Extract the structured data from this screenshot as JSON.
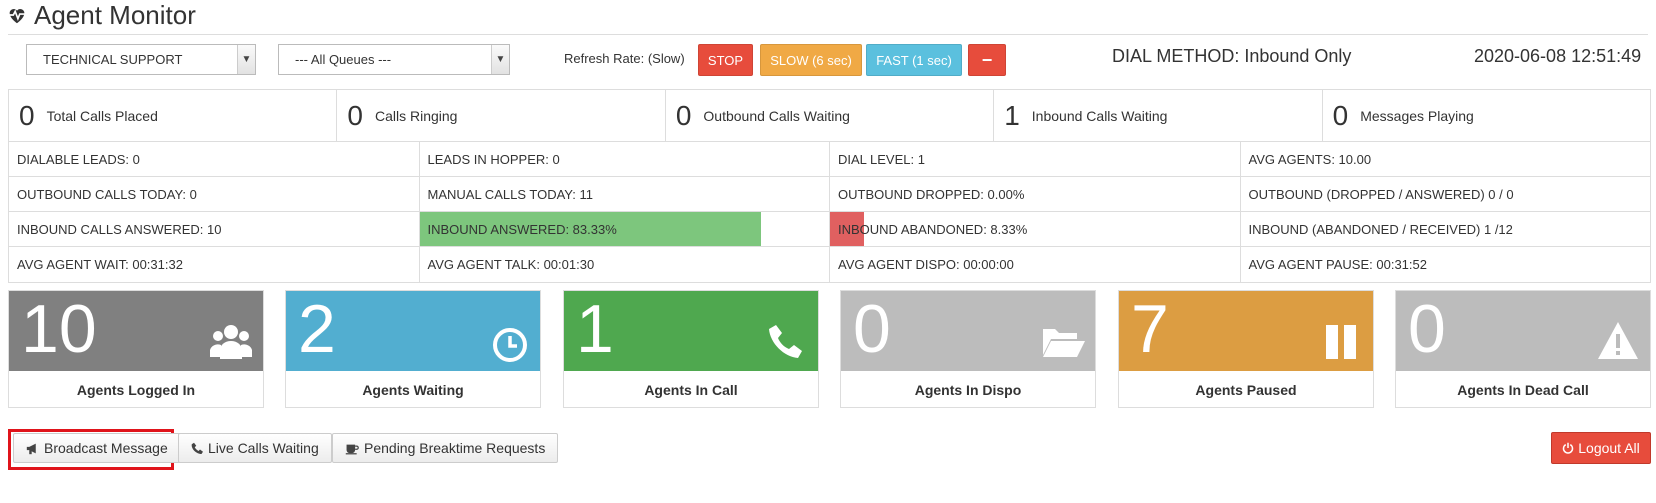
{
  "header": {
    "title": "Agent Monitor",
    "icon": "heartbeat-icon"
  },
  "filters": {
    "campaign": "TECHNICAL SUPPORT",
    "queue": "--- All Queues ---"
  },
  "refresh": {
    "label": "Refresh Rate: (Slow)",
    "stop": "STOP",
    "slow": "SLOW (6 sec)",
    "fast": "FAST (1 sec)",
    "minus": "−"
  },
  "dial_method": "DIAL METHOD: Inbound Only",
  "datetime": "2020-06-08 12:51:49",
  "counters": [
    {
      "value": "0",
      "label": "Total Calls Placed"
    },
    {
      "value": "0",
      "label": "Calls Ringing"
    },
    {
      "value": "0",
      "label": "Outbound Calls Waiting"
    },
    {
      "value": "1",
      "label": "Inbound Calls Waiting"
    },
    {
      "value": "0",
      "label": "Messages Playing"
    }
  ],
  "metrics": [
    [
      "DIALABLE LEADS: 0",
      "LEADS IN HOPPER: 0",
      "DIAL LEVEL: 1",
      "AVG AGENTS: 10.00"
    ],
    [
      "OUTBOUND CALLS TODAY: 0",
      "MANUAL CALLS TODAY: 11",
      "OUTBOUND DROPPED: 0.00%",
      "OUTBOUND (DROPPED / ANSWERED) 0 / 0"
    ],
    [
      "INBOUND CALLS ANSWERED: 10",
      "INBOUND ANSWERED: 83.33%",
      "INBOUND ABANDONED: 8.33%",
      "INBOUND (ABANDONED / RECEIVED) 1 /12"
    ],
    [
      "AVG AGENT WAIT: 00:31:32",
      "AVG AGENT TALK: 00:01:30",
      "AVG AGENT DISPO: 00:00:00",
      "AVG AGENT PAUSE: 00:31:52"
    ]
  ],
  "progress": {
    "inbound_answered_pct": 83.33,
    "inbound_abandoned_pct": 8.33,
    "answered_color": "#7dc67d",
    "abandoned_color": "#e06060"
  },
  "tiles": [
    {
      "value": "10",
      "label": "Agents Logged In",
      "color": "#808080",
      "icon": "users-icon"
    },
    {
      "value": "2",
      "label": "Agents Waiting",
      "color": "#52aed0",
      "icon": "clock-icon"
    },
    {
      "value": "1",
      "label": "Agents In Call",
      "color": "#4fa84f",
      "icon": "phone-icon"
    },
    {
      "value": "0",
      "label": "Agents In Dispo",
      "color": "#bcbcbc",
      "icon": "folder-open-icon"
    },
    {
      "value": "7",
      "label": "Agents Paused",
      "color": "#dc9d42",
      "icon": "pause-icon"
    },
    {
      "value": "0",
      "label": "Agents In Dead Call",
      "color": "#bcbcbc",
      "icon": "warning-icon"
    }
  ],
  "actions": {
    "broadcast": "Broadcast Message",
    "live_calls": "Live Calls Waiting",
    "breaktime": "Pending Breaktime Requests",
    "logout": "Logout All"
  }
}
